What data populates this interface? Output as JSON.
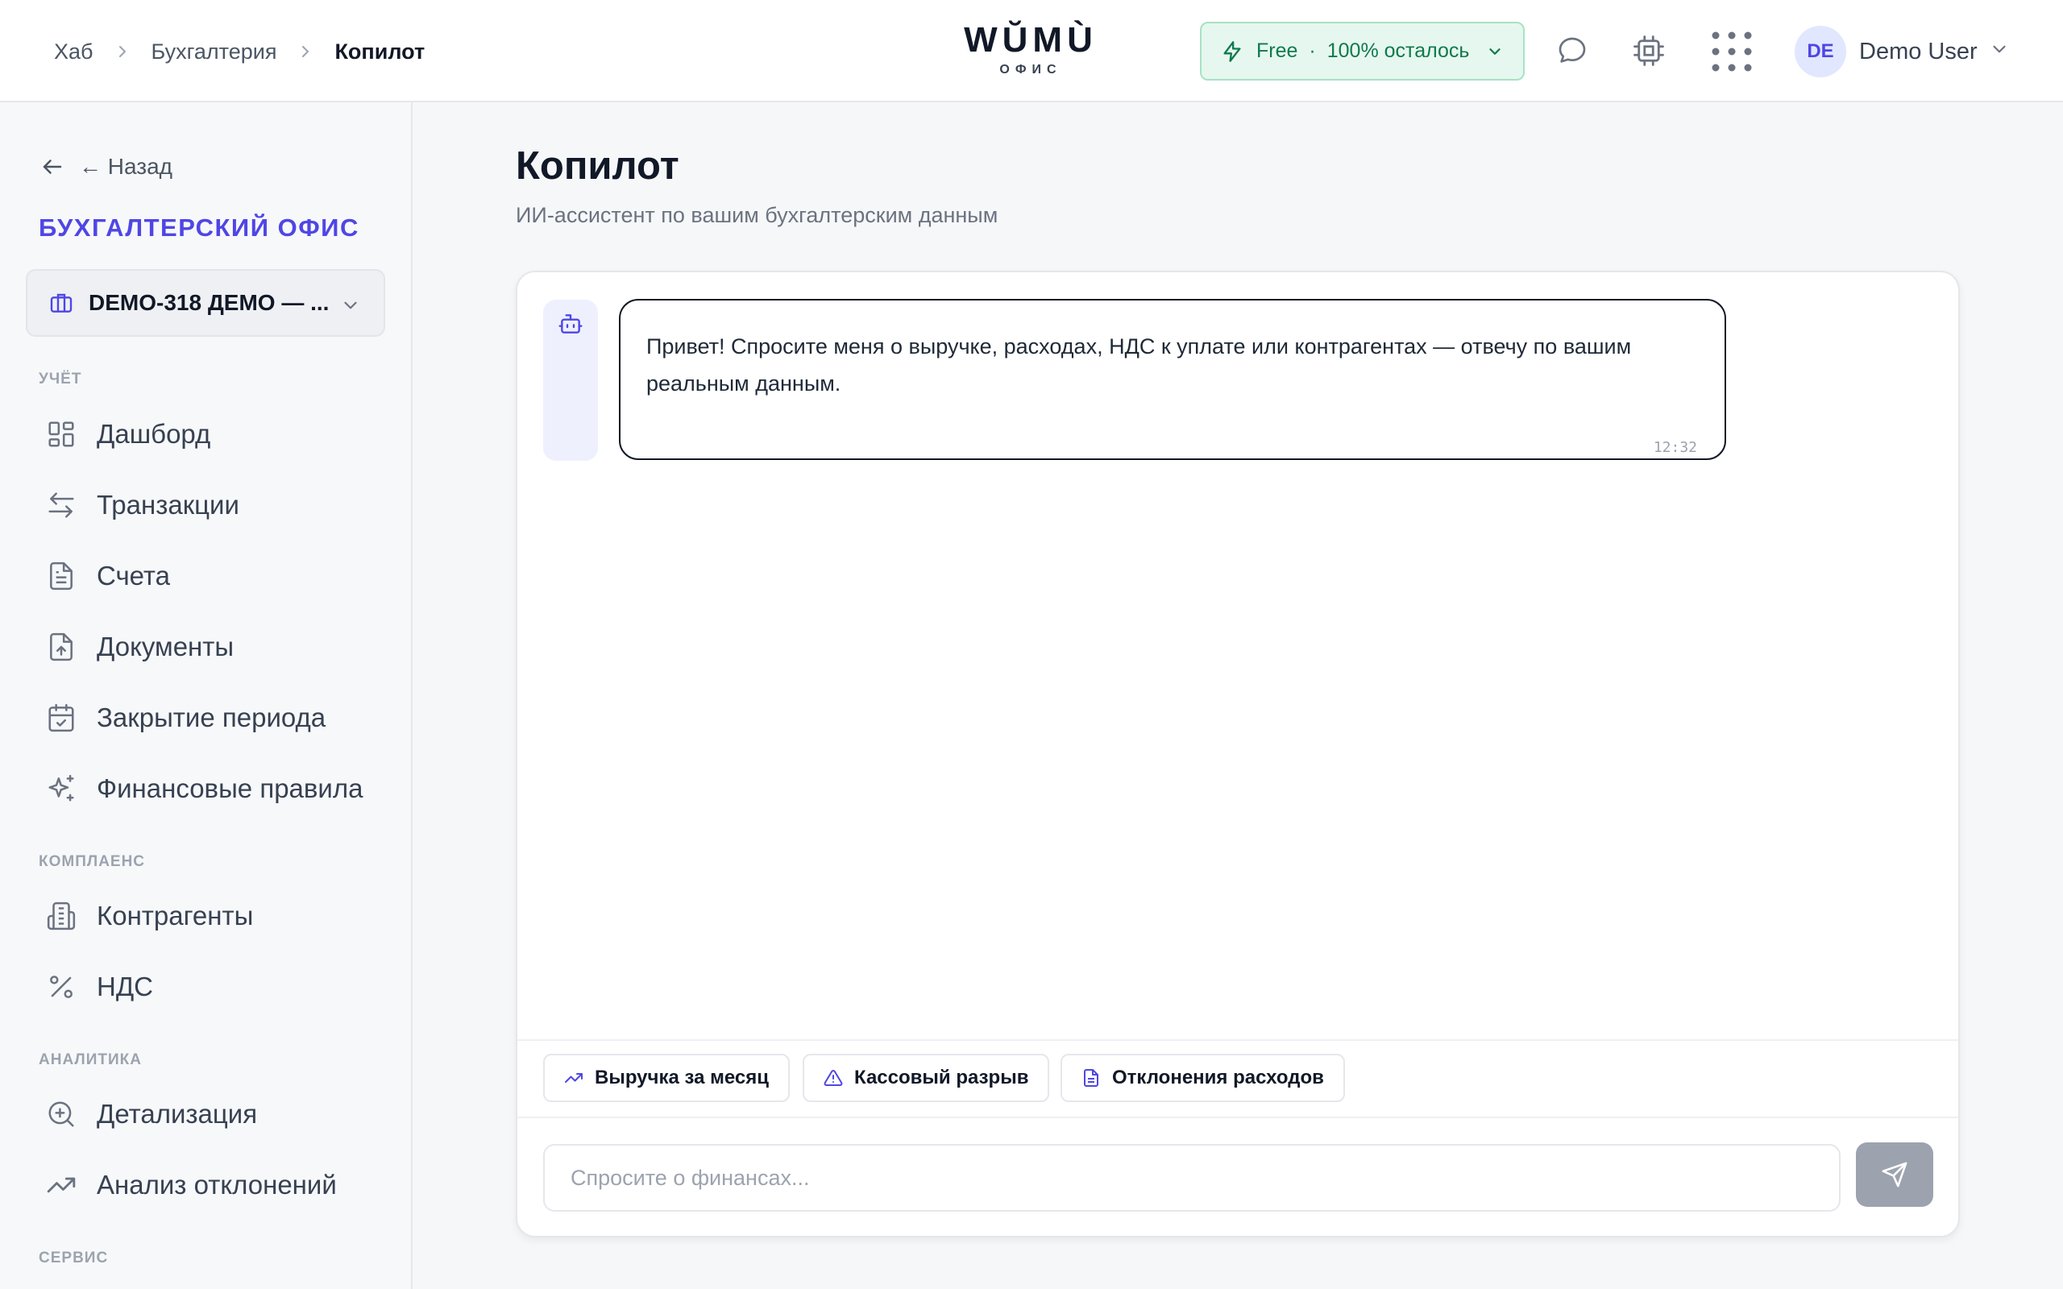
{
  "breadcrumb": {
    "items": [
      "Хаб",
      "Бухгалтерия"
    ],
    "current": "Копилот"
  },
  "logo": {
    "main": "WŬMÙ",
    "sub": "ОФИС"
  },
  "plan": {
    "name": "Free",
    "separator": "·",
    "remaining": "100% осталось"
  },
  "header_icons": [
    "chat-bubble-icon",
    "cpu-chip-icon",
    "apps-grid-icon"
  ],
  "user": {
    "initials": "DE",
    "name": "Demo User"
  },
  "sidebar": {
    "back_label": "← Назад",
    "office_title": "БУХГАЛТЕРСКИЙ ОФИС",
    "org_name": "DEMO-318 ДЕМО — ...",
    "sections": {
      "accounting": "УЧЁТ",
      "compliance": "КОМПЛАЕНС",
      "analytics": "АНАЛИТИКА",
      "service": "СЕРВИС"
    },
    "items": {
      "dashboard": "Дашборд",
      "transactions": "Транзакции",
      "invoices": "Счета",
      "documents": "Документы",
      "period_close": "Закрытие периода",
      "finance_rules": "Финансовые правила",
      "counterparties": "Контрагенты",
      "vat": "НДС",
      "drilldown": "Детализация",
      "variance": "Анализ отклонений"
    }
  },
  "main": {
    "title": "Копилот",
    "subtitle": "ИИ-ассистент по вашим бухгалтерским данным",
    "message": {
      "text": "Привет! Спросите меня о выручке, расходах, НДС к уплате или контрагентах — отвечу по вашим реальным данным.",
      "time": "12:32"
    },
    "quick_actions": [
      "Выручка за месяц",
      "Кассовый разрыв",
      "Отклонения расходов"
    ],
    "input_placeholder": "Спросите о финансах..."
  },
  "colors": {
    "accent": "#4f46e5",
    "plan_bg": "#e6f7ef",
    "plan_text": "#0f7a4d",
    "send_disabled": "#9ca3af"
  }
}
